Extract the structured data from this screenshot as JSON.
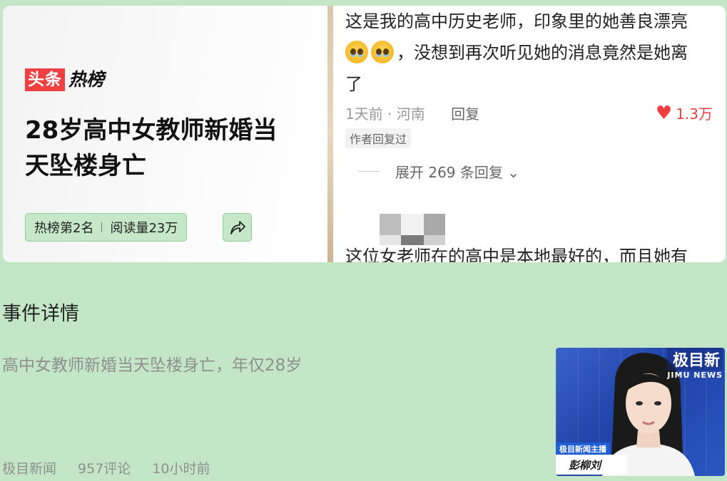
{
  "hot_card": {
    "brand_red": "头条",
    "brand_black": "热榜",
    "title": "28岁高中女教师新婚当天坠楼身亡",
    "rank": "热榜第2名",
    "reads": "阅读量23万",
    "share_icon": "share-icon"
  },
  "comments": {
    "line1": "这是我的高中历史老师，印象里的她善良漂亮",
    "line2": "，没想到再次听见她的消息竟然是她离",
    "line3": "了",
    "time_location": "1天前 · 河南",
    "reply_label": "回复",
    "likes": "1.3万",
    "author_tag": "作者回复过",
    "expand_label": "展开 269 条回复 ⌄",
    "next_comment": "这位女老师在的高中是本地最好的，而且她有"
  },
  "article": {
    "section_title": "事件详情",
    "summary": "高中女教师新婚当天坠楼身亡，年仅28岁",
    "source": "极目新闻",
    "comment_count": "957评论",
    "time": "10小时前"
  },
  "thumbnail": {
    "logo_cn": "极目新",
    "logo_en": "JIMU NEWS",
    "caption_bar": "极目新闻主播",
    "anchor_name": "彭柳刘"
  },
  "colors": {
    "background": "#c3e6c7",
    "brand_red": "#f04142",
    "like_red": "#f04142"
  }
}
